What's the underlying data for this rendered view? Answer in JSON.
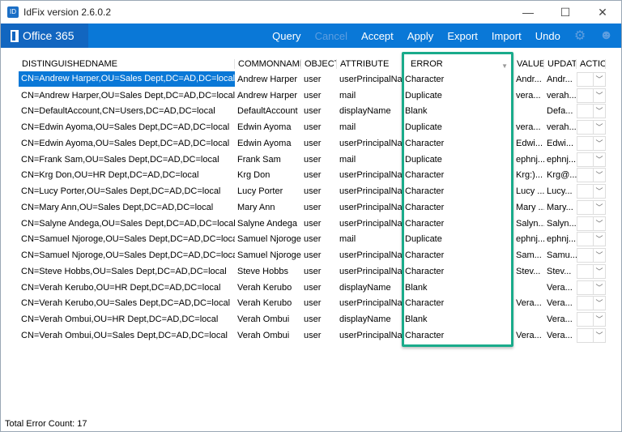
{
  "window": {
    "title": "IdFix version 2.6.0.2",
    "minimize": "—",
    "maximize": "☐",
    "close": "✕"
  },
  "ribbon": {
    "brand": "Office 365",
    "menu": [
      "Query",
      "Cancel",
      "Accept",
      "Apply",
      "Export",
      "Import",
      "Undo"
    ],
    "icons": [
      "gear-icon",
      "smiley-icon"
    ]
  },
  "table": {
    "columns": [
      "DISTINGUISHEDNAME",
      "COMMONNAME",
      "OBJECT",
      "ATTRIBUTE",
      "ERROR",
      "VALUE",
      "UPDAT",
      "ACTIO"
    ],
    "rows": [
      [
        "CN=Andrew Harper,OU=Sales Dept,DC=AD,DC=local",
        "Andrew Harper",
        "user",
        "userPrincipalNa...",
        "Character",
        "Andr...",
        "Andr..."
      ],
      [
        "CN=Andrew Harper,OU=Sales Dept,DC=AD,DC=local",
        "Andrew Harper",
        "user",
        "mail",
        "Duplicate",
        "vera...",
        "verah..."
      ],
      [
        "CN=DefaultAccount,CN=Users,DC=AD,DC=local",
        "DefaultAccount",
        "user",
        "displayName",
        "Blank",
        "",
        "Defa..."
      ],
      [
        "CN=Edwin Ayoma,OU=Sales Dept,DC=AD,DC=local",
        "Edwin Ayoma",
        "user",
        "mail",
        "Duplicate",
        "vera...",
        "verah..."
      ],
      [
        "CN=Edwin Ayoma,OU=Sales Dept,DC=AD,DC=local",
        "Edwin Ayoma",
        "user",
        "userPrincipalNa...",
        "Character",
        "Edwi...",
        "Edwi..."
      ],
      [
        "CN=Frank Sam,OU=Sales Dept,DC=AD,DC=local",
        "Frank Sam",
        "user",
        "mail",
        "Duplicate",
        "ephnj...",
        "ephnj..."
      ],
      [
        "CN=Krg Don,OU=HR Dept,DC=AD,DC=local",
        "Krg Don",
        "user",
        "userPrincipalNa...",
        "Character",
        "Krg:)...",
        "Krg@..."
      ],
      [
        "CN=Lucy Porter,OU=Sales Dept,DC=AD,DC=local",
        "Lucy Porter",
        "user",
        "userPrincipalNa...",
        "Character",
        "Lucy ...",
        "Lucy..."
      ],
      [
        "CN=Mary Ann,OU=Sales Dept,DC=AD,DC=local",
        "Mary Ann",
        "user",
        "userPrincipalNa...",
        "Character",
        "Mary ...",
        "Mary..."
      ],
      [
        "CN=Salyne Andega,OU=Sales Dept,DC=AD,DC=local",
        "Salyne Andega",
        "user",
        "userPrincipalNa...",
        "Character",
        "Salyn...",
        "Salyn..."
      ],
      [
        "CN=Samuel Njoroge,OU=Sales Dept,DC=AD,DC=local",
        "Samuel Njoroge",
        "user",
        "mail",
        "Duplicate",
        "ephnj...",
        "ephnj..."
      ],
      [
        "CN=Samuel Njoroge,OU=Sales Dept,DC=AD,DC=local",
        "Samuel Njoroge",
        "user",
        "userPrincipalNa...",
        "Character",
        "Sam...",
        "Samu..."
      ],
      [
        "CN=Steve Hobbs,OU=Sales Dept,DC=AD,DC=local",
        "Steve Hobbs",
        "user",
        "userPrincipalNa...",
        "Character",
        "Stev...",
        "Stev..."
      ],
      [
        "CN=Verah Kerubo,OU=HR Dept,DC=AD,DC=local",
        "Verah Kerubo",
        "user",
        "displayName",
        "Blank",
        "",
        "Vera..."
      ],
      [
        "CN=Verah Kerubo,OU=Sales Dept,DC=AD,DC=local",
        "Verah Kerubo",
        "user",
        "userPrincipalNa...",
        "Character",
        "Vera...",
        "Vera..."
      ],
      [
        "CN=Verah Ombui,OU=HR Dept,DC=AD,DC=local",
        "Verah Ombui",
        "user",
        "displayName",
        "Blank",
        "",
        "Vera..."
      ],
      [
        "CN=Verah Ombui,OU=Sales Dept,DC=AD,DC=local",
        "Verah Ombui",
        "user",
        "userPrincipalNa...",
        "Character",
        "Vera...",
        "Vera..."
      ]
    ]
  },
  "status": "Total Error Count: 17",
  "colors": {
    "accent": "#0a78d7",
    "highlight": "#1aab8b"
  }
}
